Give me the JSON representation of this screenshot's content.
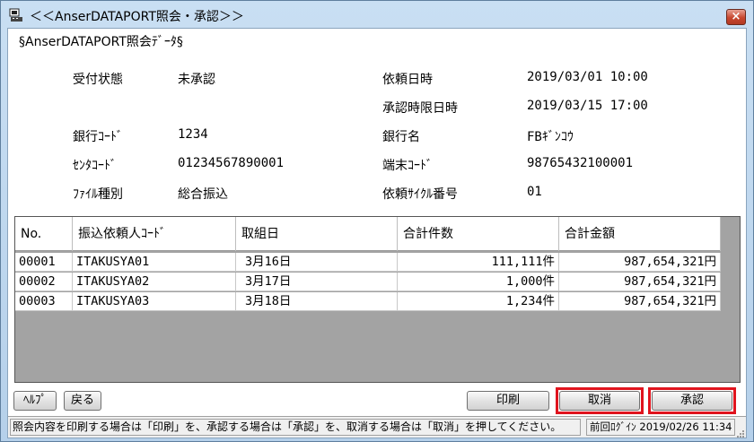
{
  "window": {
    "title": "＜＜AnserDATAPORT照会・承認＞＞",
    "close_label": "×"
  },
  "section_title": "§AnserDATAPORT照会ﾃﾞｰﾀ§",
  "fields": {
    "reception_status_label": "受付状態",
    "reception_status_value": "未承認",
    "request_datetime_label": "依頼日時",
    "request_datetime_value": "2019/03/01 10:00",
    "approval_deadline_label": "承認時限日時",
    "approval_deadline_value": "2019/03/15 17:00",
    "bank_code_label": "銀行ｺｰﾄﾞ",
    "bank_code_value": "1234",
    "bank_name_label": "銀行名",
    "bank_name_value": "FBｷﾞﾝｺｳ",
    "center_code_label": "ｾﾝﾀｺｰﾄﾞ",
    "center_code_value": "01234567890001",
    "terminal_code_label": "端末ｺｰﾄﾞ",
    "terminal_code_value": "98765432100001",
    "file_type_label": "ﾌｧｲﾙ種別",
    "file_type_value": "総合振込",
    "request_cycle_label": "依頼ｻｲｸﾙ番号",
    "request_cycle_value": "01"
  },
  "table": {
    "headers": [
      "No.",
      "振込依頼人ｺｰﾄﾞ",
      "取組日",
      "合計件数",
      "合計金額"
    ],
    "rows": [
      {
        "no": "00001",
        "requester_code": "ITAKUSYA01",
        "date": "3月16日",
        "count": "111,111件",
        "amount": "987,654,321円"
      },
      {
        "no": "00002",
        "requester_code": "ITAKUSYA02",
        "date": "3月17日",
        "count": "1,000件",
        "amount": "987,654,321円"
      },
      {
        "no": "00003",
        "requester_code": "ITAKUSYA03",
        "date": "3月18日",
        "count": "1,234件",
        "amount": "987,654,321円"
      }
    ]
  },
  "buttons": {
    "help": "ﾍﾙﾌﾟ",
    "back": "戻る",
    "print": "印刷",
    "cancel": "取消",
    "approve": "承認"
  },
  "status": {
    "message": "照会内容を印刷する場合は「印刷」を、承認する場合は「承認」を、取消する場合は「取消」を押してください。",
    "last_login": "前回ﾛｸﾞｲﾝ 2019/02/26 11:34"
  },
  "colors": {
    "highlight": "#e0141e",
    "grid_background": "#a3a3a3"
  },
  "icons": {
    "title": "app-icon",
    "close": "close-icon"
  }
}
